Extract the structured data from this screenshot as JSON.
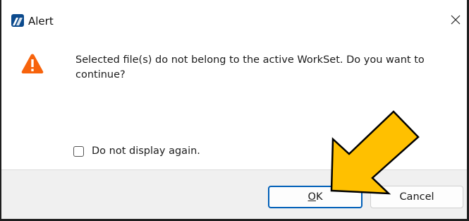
{
  "window": {
    "title": "Alert",
    "app_icon": "app-logo-icon",
    "close_icon": "close-icon"
  },
  "alert": {
    "icon": "warning-icon",
    "message": "Selected file(s) do not belong to the active WorkSet. Do you want to continue?",
    "checkbox_label": "Do not display again.",
    "checkbox_checked": false
  },
  "buttons": {
    "ok_mnemonic": "O",
    "ok_rest": "K",
    "cancel_label": "Cancel"
  },
  "colors": {
    "arrow_fill": "#ffc000",
    "arrow_stroke": "#000000",
    "warning": "#f7630c",
    "default_button_border": "#005fb8"
  }
}
